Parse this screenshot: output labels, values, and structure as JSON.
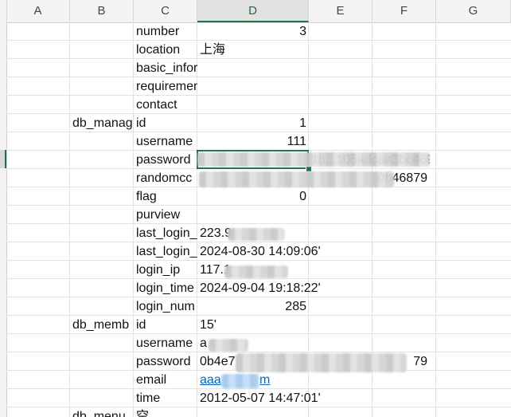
{
  "columns": [
    "A",
    "B",
    "C",
    "D",
    "E",
    "F",
    "G"
  ],
  "active_column": "D",
  "rows": [
    {
      "b": "",
      "c": "number",
      "d": "3",
      "d_num": true
    },
    {
      "b": "",
      "c": "location",
      "d": "上海"
    },
    {
      "b": "",
      "c": "basic_information",
      "d": ""
    },
    {
      "b": "",
      "c": "requirements",
      "d": ""
    },
    {
      "b": "",
      "c": "contact",
      "d": ""
    },
    {
      "b": "db_manag",
      "c": "id",
      "d": "1",
      "d_num": true
    },
    {
      "b": "",
      "c": "username",
      "d": "111",
      "d_num": true
    },
    {
      "b": "",
      "c": "password",
      "d": "",
      "e": "1b...105adcaa3bc469"
    },
    {
      "b": "",
      "c": "randomcc",
      "d": "",
      "e": "0b46879"
    },
    {
      "b": "",
      "c": "flag",
      "d": "0",
      "d_num": true
    },
    {
      "b": "",
      "c": "purview",
      "d": ""
    },
    {
      "b": "",
      "c": "last_login_",
      "d": "223.9"
    },
    {
      "b": "",
      "c": "last_login_",
      "d": "2024-08-30 14:09:06'"
    },
    {
      "b": "",
      "c": "login_ip",
      "d": "117.1"
    },
    {
      "b": "",
      "c": "login_time",
      "d": "2024-09-04 19:18:22'"
    },
    {
      "b": "",
      "c": "login_num",
      "d": "285",
      "d_num": true
    },
    {
      "b": "db_memb",
      "c": "id",
      "d": "15'"
    },
    {
      "b": "",
      "c": "username",
      "d": "a"
    },
    {
      "b": "",
      "c": "password",
      "d": "0b4e7",
      "e": "79"
    },
    {
      "b": "",
      "c": "email",
      "d": "aaa",
      "d_tail": "m",
      "d_link": true
    },
    {
      "b": "",
      "c": "time",
      "d": "2012-05-07 14:47:01'"
    },
    {
      "b": "db_menu",
      "c": "空",
      "d": ""
    }
  ]
}
